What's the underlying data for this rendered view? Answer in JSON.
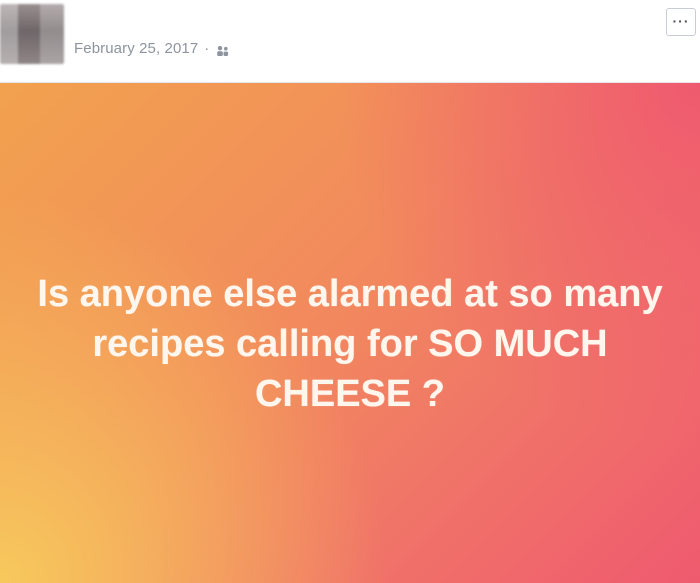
{
  "post": {
    "date": "February 25, 2017",
    "separator": "·",
    "audience_icon": "friends-icon",
    "more_label": "···",
    "status_text": "Is anyone else alarmed at so many recipes calling for SO MUCH CHEESE ?",
    "background_colors": [
      "#f7c95c",
      "#f2a24f",
      "#f28a5d",
      "#ef5a6f"
    ]
  }
}
